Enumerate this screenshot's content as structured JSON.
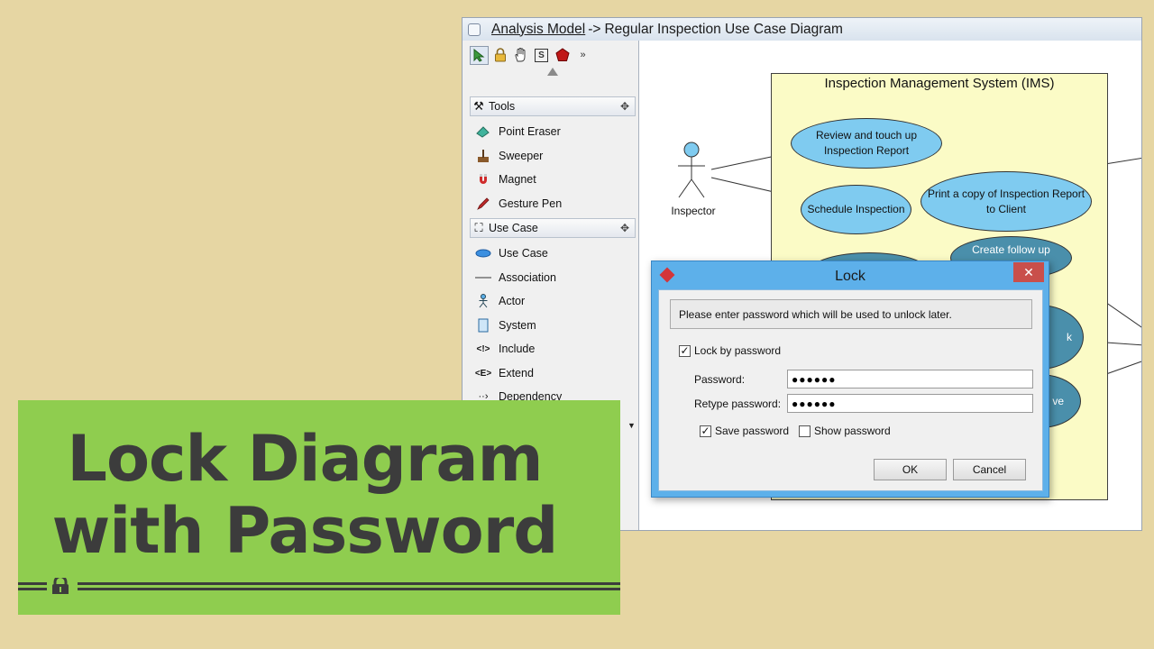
{
  "window": {
    "breadcrumb_link": "Analysis Model",
    "breadcrumb_sep": "->",
    "diagram_name": "Regular Inspection Use Case Diagram"
  },
  "toolbar": {
    "icons": [
      "select-arrow-icon",
      "lock-icon",
      "hand-icon",
      "s-icon",
      "pentagon-icon",
      "more-chevron-icon"
    ]
  },
  "palette": {
    "tools_section": "Tools",
    "tools": [
      "Point Eraser",
      "Sweeper",
      "Magnet",
      "Gesture Pen"
    ],
    "usecase_section": "Use Case",
    "usecase_items": [
      "Use Case",
      "Association",
      "Actor",
      "System",
      "Include",
      "Extend",
      "Dependency"
    ]
  },
  "diagram": {
    "system_title": "Inspection Management System (IMS)",
    "actor": "Inspector",
    "usecases": [
      "Review and touch up Inspection Report",
      "Schedule Inspection",
      "Print a copy of Inspection Report to Client",
      "Create follow up"
    ],
    "partial_usecase_a": "k",
    "partial_usecase_b": "ve"
  },
  "dialog": {
    "title": "Lock",
    "message": "Please enter password which will be used to unlock later.",
    "lock_by_password": "Lock by password",
    "password_label": "Password:",
    "password_value": "●●●●●●",
    "retype_label": "Retype password:",
    "retype_value": "●●●●●●",
    "save_password": "Save password",
    "show_password": "Show password",
    "ok": "OK",
    "cancel": "Cancel",
    "close_glyph": "✕"
  },
  "banner": {
    "line1": "Lock Diagram",
    "line2": "with Password"
  },
  "colors": {
    "background": "#e6d6a3",
    "banner": "#8fcd4f",
    "usecase": "#7fcbf0",
    "system": "#fbfbc6",
    "dialog_frame": "#5db0ea"
  }
}
